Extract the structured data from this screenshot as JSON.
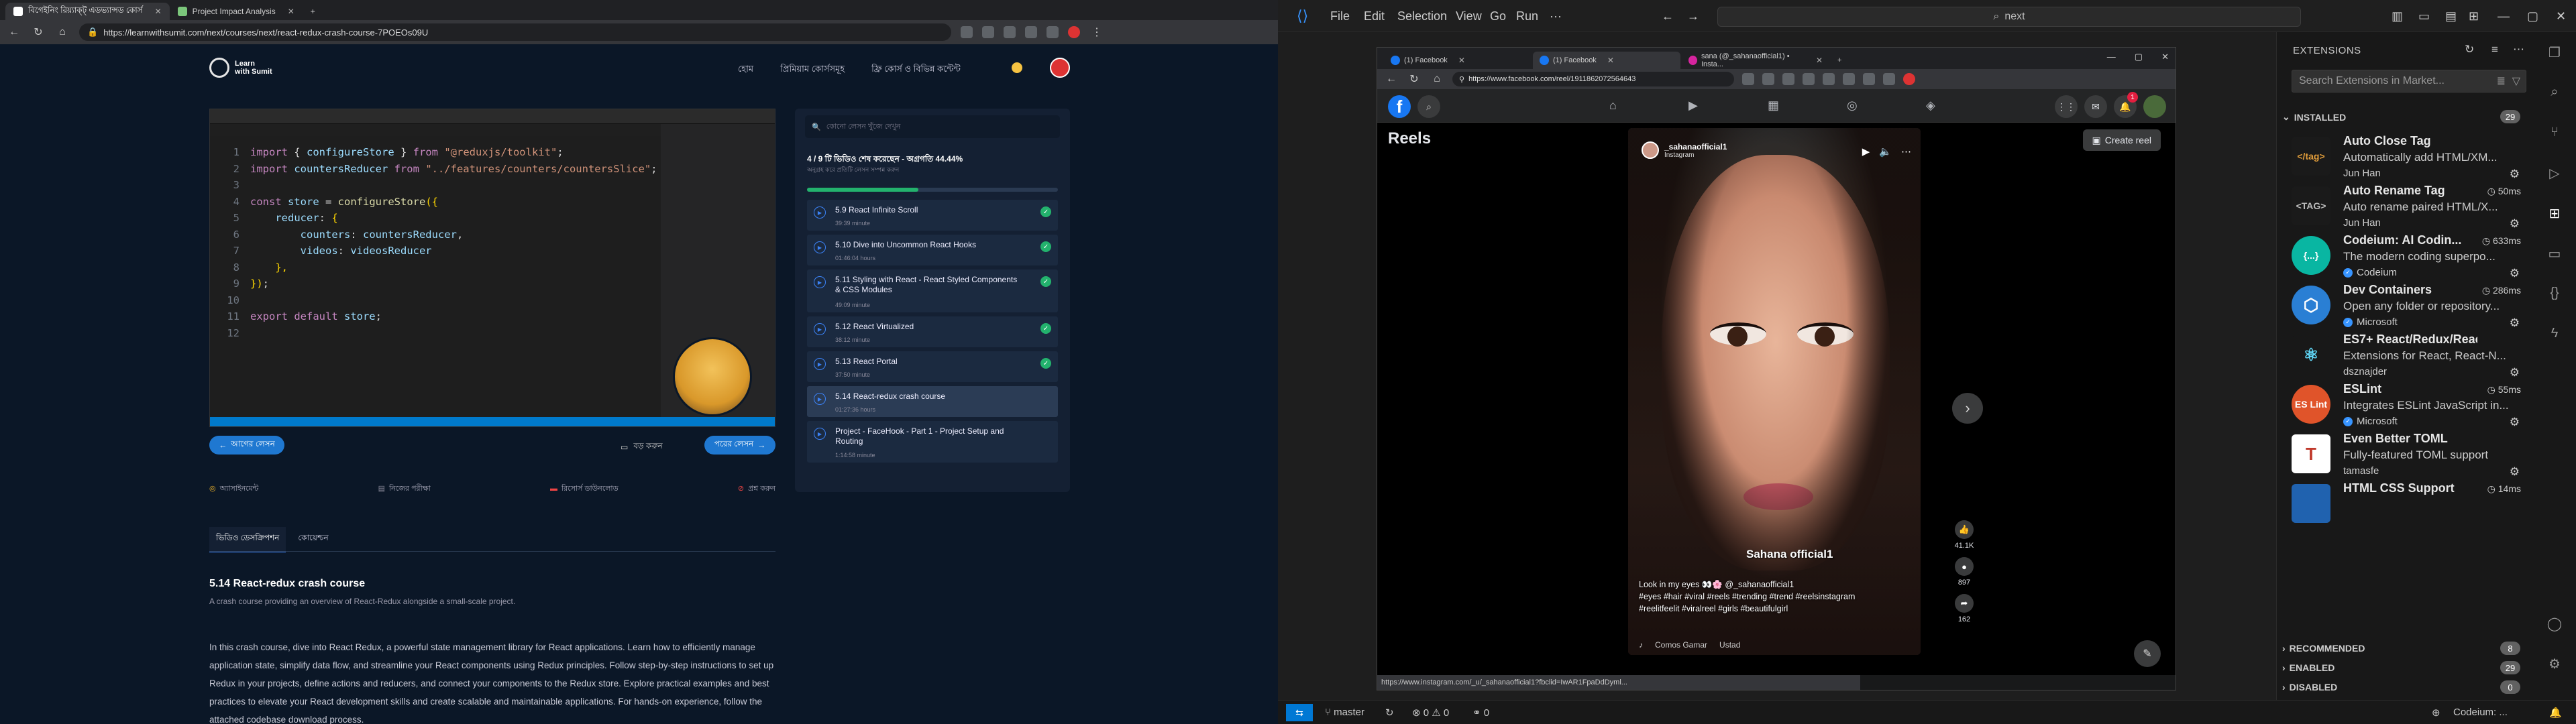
{
  "left_browser": {
    "tabs": [
      {
        "label": "বিগেইনিং রিয়্যাক্ট্‌ এডভ্যান্সড কোর্স",
        "active": true
      },
      {
        "label": "Project Impact Analysis",
        "active": false
      }
    ],
    "url": "https://learnwithsumit.com/next/courses/next/react-redux-crash-course-7POEOs09U",
    "site": {
      "logo_line1": "Learn",
      "logo_line2": "with Sumit",
      "nav": [
        "হোম",
        "প্রিমিয়াম কোর্সসমূহ",
        "ফ্রি কোর্স ও বিভিন্ন কন্টেন্ট"
      ]
    },
    "code_editor": {
      "lines": [
        {
          "n": "1",
          "parts": [
            [
              "kw",
              "import "
            ],
            [
              "pl",
              "{ "
            ],
            [
              "vr",
              "configureStore"
            ],
            [
              "pl",
              " } "
            ],
            [
              "kw",
              "from "
            ],
            [
              "st",
              "\"@reduxjs/toolkit\""
            ],
            [
              "pl",
              ";"
            ]
          ]
        },
        {
          "n": "2",
          "parts": [
            [
              "kw",
              "import "
            ],
            [
              "vr",
              "countersReducer "
            ],
            [
              "kw",
              "from "
            ],
            [
              "st",
              "\"../features/counters/countersSlice\""
            ],
            [
              "pl",
              ";"
            ]
          ]
        },
        {
          "n": "3",
          "parts": []
        },
        {
          "n": "4",
          "parts": [
            [
              "kw",
              "const "
            ],
            [
              "vr",
              "store "
            ],
            [
              "pl",
              "= "
            ],
            [
              "fn",
              "configureStore"
            ],
            [
              "br",
              "({"
            ]
          ]
        },
        {
          "n": "5",
          "parts": [
            [
              "pl",
              "    "
            ],
            [
              "vr",
              "reducer"
            ],
            [
              "pl",
              ": "
            ],
            [
              "br",
              "{"
            ]
          ]
        },
        {
          "n": "6",
          "parts": [
            [
              "pl",
              "        "
            ],
            [
              "vr",
              "counters"
            ],
            [
              "pl",
              ": "
            ],
            [
              "vr",
              "countersReducer"
            ],
            [
              "pl",
              ","
            ]
          ]
        },
        {
          "n": "7",
          "parts": [
            [
              "pl",
              "        "
            ],
            [
              "vr",
              "videos"
            ],
            [
              "pl",
              ": "
            ],
            [
              "vr",
              "videosReducer"
            ]
          ]
        },
        {
          "n": "8",
          "parts": [
            [
              "pl",
              "    "
            ],
            [
              "br",
              "},"
            ]
          ]
        },
        {
          "n": "9",
          "parts": [
            [
              "br",
              "})"
            ],
            [
              "pl",
              ";"
            ]
          ]
        },
        {
          "n": "10",
          "parts": []
        },
        {
          "n": "11",
          "parts": [
            [
              "kw",
              "export default "
            ],
            [
              "vr",
              "store"
            ],
            [
              "pl",
              ";"
            ]
          ]
        },
        {
          "n": "12",
          "parts": []
        }
      ]
    },
    "player_controls": {
      "prev_label": "আগের লেসন",
      "fullscreen_label": "বড় করুন",
      "next_label": "পরের লেসন"
    },
    "qa_row": [
      "অ্যাসাইনমেন্ট",
      "নিজের পরীক্ষা",
      "রিসোর্স ডাউনলোড",
      "প্রশ্ন করুন"
    ],
    "lessons_panel": {
      "search_placeholder": "কোনো লেসন খুঁজে দেখুন",
      "progress_text": "4 / 9 টি ভিডিও শেষ করেছেন - অগ্রগতি 44.44%",
      "progress_sub": "অনুগ্রহ করে প্রতিটি লেসন সম্পন্ন করুন",
      "progress_fraction": 0.4444,
      "lessons": [
        {
          "title": "5.9 React Infinite Scroll",
          "duration": "39:39 minute",
          "done": true,
          "active": false
        },
        {
          "title": "5.10 Dive into Uncommon React Hooks",
          "duration": "01:46:04 hours",
          "done": true,
          "active": false
        },
        {
          "title": "5.11 Styling with React - React Styled Components & CSS Modules",
          "duration": "49:09 minute",
          "done": true,
          "active": false
        },
        {
          "title": "5.12 React Virtualized",
          "duration": "38:12 minute",
          "done": true,
          "active": false
        },
        {
          "title": "5.13 React Portal",
          "duration": "37:50 minute",
          "done": true,
          "active": false
        },
        {
          "title": "5.14 React-redux crash course",
          "duration": "01:27:36 hours",
          "done": false,
          "active": true
        },
        {
          "title": "Project - FaceHook - Part 1 - Project Setup and Routing",
          "duration": "1:14:58 minute",
          "done": false,
          "active": false
        }
      ]
    },
    "content_tabs": [
      "ভিডিও ডেসক্রিপশন",
      "কোয়েশ্চন"
    ],
    "course": {
      "title": "5.14 React-redux crash course",
      "subtitle": "A crash course providing an overview of React-Redux alongside a small-scale project.",
      "description": "In this crash course, dive into React Redux, a powerful state management library for React applications. Learn how to efficiently manage application state, simplify data flow, and streamline your React components using Redux principles. Follow step-by-step instructions to set up Redux in your projects, define actions and reducers, and connect your components to the Redux store. Explore practical examples and best practices to elevate your React development skills and create scalable and maintainable applications. For hands-on experience, follow the attached codebase download process."
    }
  },
  "vscode": {
    "menu": [
      "File",
      "Edit",
      "Selection",
      "View",
      "Go",
      "Run",
      "···"
    ],
    "command_center": "next",
    "status": {
      "branch": "master",
      "problems_errors": "0",
      "problems_warnings": "0",
      "ports": "0",
      "codeium": "Codeium: ..."
    },
    "extensions": {
      "title": "EXTENSIONS",
      "search_placeholder": "Search Extensions in Market...",
      "installed_label": "INSTALLED",
      "installed_count": "29",
      "recommended_label": "RECOMMENDED",
      "recommended_count": "8",
      "enabled_label": "ENABLED",
      "enabled_count": "29",
      "disabled_label": "DISABLED",
      "disabled_count": "0",
      "items": [
        {
          "name": "Auto Close Tag",
          "time": "",
          "desc": "Automatically add HTML/XM...",
          "publisher": "Jun Han",
          "verified": false,
          "icon_text": "</tag>",
          "icon_bg": "#1a1a1a",
          "icon_fg": "#e09c3a"
        },
        {
          "name": "Auto Rename Tag",
          "time": "50ms",
          "desc": "Auto rename paired HTML/X...",
          "publisher": "Jun Han",
          "verified": false,
          "icon_text": "<TAG>",
          "icon_bg": "#1a1a1a",
          "icon_fg": "#bbbbbb"
        },
        {
          "name": "Codeium: AI Codin...",
          "time": "633ms",
          "desc": "The modern coding superpo...",
          "publisher": "Codeium",
          "verified": true,
          "icon_text": "{...}",
          "icon_bg": "#09b6a2",
          "icon_fg": "#ffffff"
        },
        {
          "name": "Dev Containers",
          "time": "286ms",
          "desc": "Open any folder or repository...",
          "publisher": "Microsoft",
          "verified": true,
          "icon_text": "⬡",
          "icon_bg": "#2a7fd4",
          "icon_fg": "#ffffff"
        },
        {
          "name": "ES7+ React/Redux/React-N...",
          "time": "",
          "desc": "Extensions for React, React-N...",
          "publisher": "dsznajder",
          "verified": false,
          "icon_text": "⚛",
          "icon_bg": "#181818",
          "icon_fg": "#61dafb"
        },
        {
          "name": "ESLint",
          "time": "55ms",
          "desc": "Integrates ESLint JavaScript in...",
          "publisher": "Microsoft",
          "verified": true,
          "icon_text": "ES Lint",
          "icon_bg": "#e0542a",
          "icon_fg": "#ffffff"
        },
        {
          "name": "Even Better TOML",
          "time": "",
          "desc": "Fully-featured TOML support",
          "publisher": "tamasfe",
          "verified": false,
          "icon_text": "T",
          "icon_bg": "#ffffff",
          "icon_fg": "#c0392b"
        },
        {
          "name": "HTML CSS Support",
          "time": "14ms",
          "desc": "",
          "publisher": "",
          "verified": false,
          "icon_text": "",
          "icon_bg": "#2062af",
          "icon_fg": "#ffffff"
        }
      ]
    }
  },
  "facebook_window": {
    "tabs": [
      {
        "label": "(1) Facebook",
        "active": false
      },
      {
        "label": "(1) Facebook",
        "active": true
      },
      {
        "label": "sana (@_sahanaofficial1) • Insta...",
        "active": false
      }
    ],
    "url": "https://www.facebook.com/reel/1911862072564643",
    "notif_count": "1",
    "reels_title": "Reels",
    "create_reel": "Create reel",
    "reel": {
      "username": "_sahanaofficial1",
      "source": "Instagram",
      "tag_text": "Sahana official1",
      "caption": "Look in my eyes 👀🌸 @_sahanaofficial1",
      "hashtags": "#eyes #hair #viral #reels #trending #trend #reelsinstagram #reelitfeelit #viralreel #girls #beautifulgirl",
      "music": [
        "Comos Gamar",
        "Ustad"
      ],
      "likes": "41.1K",
      "comments": "897",
      "shares": "162"
    },
    "status_url": "https://www.instagram.com/_u/_sahanaofficial1?fbclid=IwAR1FpaDdDyml..."
  },
  "colors": {
    "vscode_remote": "#0078d4",
    "fb_blue": "#1877f2",
    "lesson_done": "#23b26d",
    "accent_blue": "#1f78d1"
  }
}
